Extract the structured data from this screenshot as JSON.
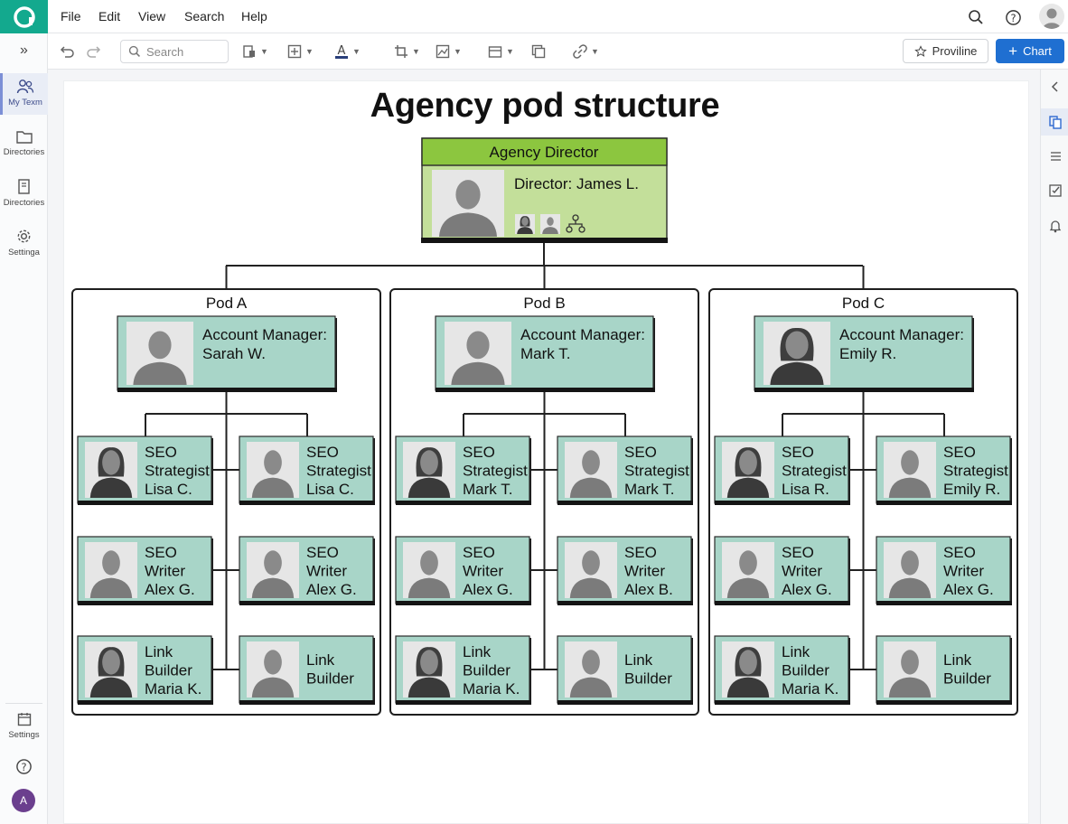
{
  "app": {
    "logo_icon": "app-logo-icon",
    "accent": "#13a98e"
  },
  "menubar": {
    "items": [
      "File",
      "Edit",
      "View",
      "Search",
      "Help"
    ]
  },
  "toolbar": {
    "search_placeholder": "Search",
    "proviline_label": "Proviline",
    "chart_label": "Chart",
    "chart_btn_color": "#1f6fd1"
  },
  "sidebar": {
    "expand_icon": "»",
    "items": [
      {
        "label": "My Texm",
        "icon": "people-icon"
      },
      {
        "label": "Directories",
        "icon": "folder-icon"
      },
      {
        "label": "Directories",
        "icon": "document-icon"
      },
      {
        "label": "Settinga",
        "icon": "gear-icon"
      }
    ],
    "bottom_settings_label": "Settings",
    "avatar_letter": "A"
  },
  "chart": {
    "title": "Agency pod structure",
    "director": {
      "header": "Agency Director",
      "name": "Director: James L.",
      "header_color": "#8cc63f",
      "body_color": "#c3df9a"
    },
    "card_color": "#a8d5c8",
    "pods": [
      {
        "name": "Pod A",
        "manager": {
          "line1": "Account Manager:",
          "line2": "Sarah W.",
          "gender": "m"
        },
        "members": [
          {
            "lines": [
              "SEO",
              "Strategist",
              "Lisa C."
            ],
            "gender": "f"
          },
          {
            "lines": [
              "SEO",
              "Strategist",
              "Lisa C."
            ],
            "gender": "m"
          },
          {
            "lines": [
              "SEO",
              "Writer",
              "Alex G."
            ],
            "gender": "m"
          },
          {
            "lines": [
              "SEO",
              "Writer",
              "Alex G."
            ],
            "gender": "m"
          },
          {
            "lines": [
              "Link",
              "Builder",
              "Maria K."
            ],
            "gender": "f"
          },
          {
            "lines": [
              "Link",
              "Builder"
            ],
            "gender": "m"
          }
        ]
      },
      {
        "name": "Pod B",
        "manager": {
          "line1": "Account Manager:",
          "line2": "Mark T.",
          "gender": "m"
        },
        "members": [
          {
            "lines": [
              "SEO",
              "Strategist",
              "Mark T."
            ],
            "gender": "f"
          },
          {
            "lines": [
              "SEO",
              "Strategist",
              "Mark T."
            ],
            "gender": "m"
          },
          {
            "lines": [
              "SEO",
              "Writer",
              "Alex G."
            ],
            "gender": "m"
          },
          {
            "lines": [
              "SEO",
              "Writer",
              "Alex B."
            ],
            "gender": "m"
          },
          {
            "lines": [
              "Link",
              "Builder",
              "Maria K."
            ],
            "gender": "f"
          },
          {
            "lines": [
              "Link",
              "Builder"
            ],
            "gender": "m"
          }
        ]
      },
      {
        "name": "Pod C",
        "manager": {
          "line1": "Account Manager:",
          "line2": "Emily R.",
          "gender": "f"
        },
        "members": [
          {
            "lines": [
              "SEO",
              "Strategist",
              "Lisa R."
            ],
            "gender": "f"
          },
          {
            "lines": [
              "SEO",
              "Strategist",
              "Emily R."
            ],
            "gender": "m"
          },
          {
            "lines": [
              "SEO",
              "Writer",
              "Alex G."
            ],
            "gender": "m"
          },
          {
            "lines": [
              "SEO",
              "Writer",
              "Alex G."
            ],
            "gender": "m"
          },
          {
            "lines": [
              "Link",
              "Builder",
              "Maria K."
            ],
            "gender": "f"
          },
          {
            "lines": [
              "Link",
              "Builder"
            ],
            "gender": "m"
          }
        ]
      }
    ]
  }
}
